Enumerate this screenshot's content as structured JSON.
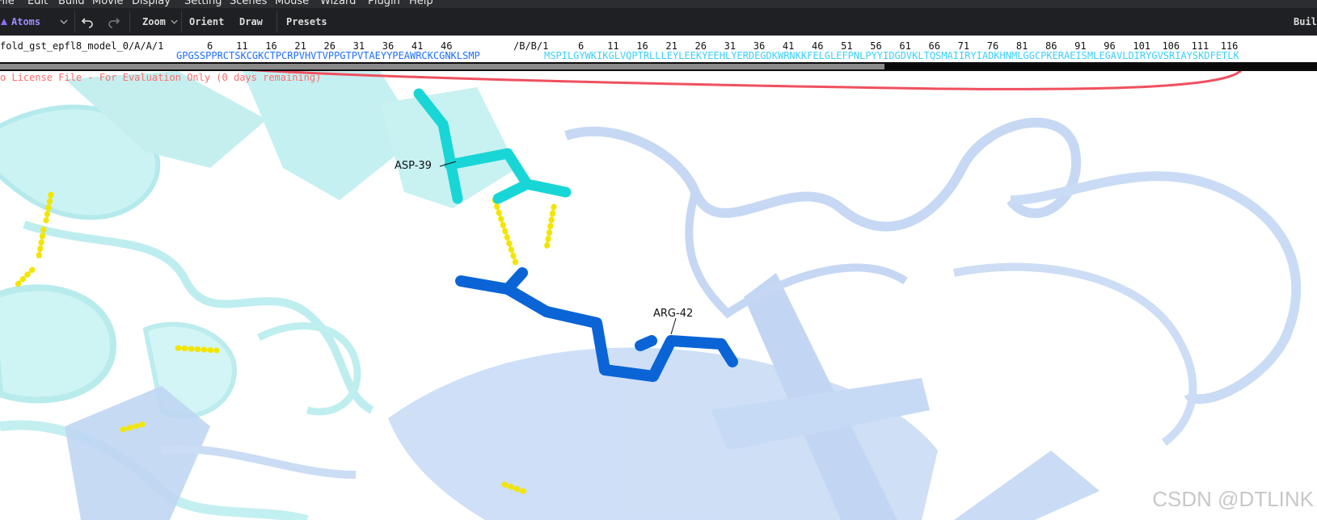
{
  "menu": [
    "File",
    "Edit",
    "Build",
    "Movie",
    "Display",
    "Setting",
    "Scenes",
    "Mouse",
    "Wizard",
    "Plugin",
    "Help"
  ],
  "toolbar": {
    "atoms_label": "Atoms",
    "zoom_label": "Zoom",
    "orient_label": "Orient",
    "draw_label": "Draw",
    "presets_label": "Presets",
    "build_label": "Buil"
  },
  "sequence": {
    "chain_a_label": "fold_gst_epfl8_model_0/A/A/1",
    "chain_a_ticks": "6    11   16   21   26   31   36   41   46",
    "chain_a_seq": "GPGSSPPRCTSKCGKCTPCRPVHVTVPPGTPVTAEYYPEAWRCKCGNKLSMP",
    "chain_b_label": "/B/B/1",
    "chain_b_ticks": "6    11   16   21   26   31   36   41   46   51   56   61   66   71   76   81   86   91   96   101  106  111  116",
    "chain_b_seq": "MSPILGYWKIKGLVQPTRLLLEYLEEKYEEHLYERDEGDKWRNKKFELGLEFPNLPYYIDGDVKLTQSMAIIRYIADKHNMLGGCPKERAEISMLEGAVLDIRYGVSRIAYSKDFETLK"
  },
  "viewport": {
    "license_text": "o License File - For Evaluation Only (0 days remaining)",
    "residue_labels": {
      "asp": "ASP-39",
      "arg": "ARG-42"
    },
    "watermark": "CSDN @DTLINK"
  },
  "colors": {
    "menubar_bg": "#2b2d30",
    "toolbar_bg": "#1f2023",
    "chain_a": "#1e6fff",
    "chain_b": "#3ad0ff",
    "asp_stick": "#19d6d6",
    "arg_stick": "#0a64d6",
    "hbond": "#f2e600",
    "annotation_circle": "#f0505f",
    "license": "#ff6b6b"
  },
  "icons": [
    "atoms-icon",
    "chevron-down-icon",
    "undo-icon",
    "redo-icon"
  ]
}
